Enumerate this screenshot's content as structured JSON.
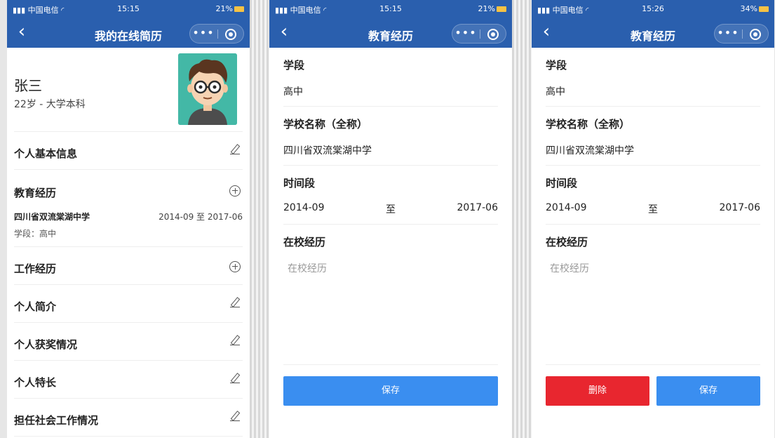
{
  "status": {
    "carrier": "中国电信",
    "panel1_time": "15:15",
    "panel2_time": "15:15",
    "panel3_time": "15:26",
    "panel1_battery": "21%",
    "panel2_battery": "21%",
    "panel3_battery": "34%"
  },
  "resume": {
    "nav_title": "我的在线简历",
    "name": "张三",
    "meta": "22岁 - 大学本科",
    "sections": {
      "basic": "个人基本信息",
      "education": "教育经历",
      "work": "工作经历",
      "intro": "个人简介",
      "awards": "个人获奖情况",
      "skills": "个人特长",
      "social": "担任社会工作情况"
    },
    "education_entry": {
      "school": "四川省双流棠湖中学",
      "dates": "2014-09 至 2017-06",
      "stage": "学段：高中"
    }
  },
  "edu_form": {
    "nav_title": "教育经历",
    "stage_label": "学段",
    "stage_value": "高中",
    "school_label": "学校名称（全称）",
    "school_value": "四川省双流棠湖中学",
    "period_label": "时间段",
    "period_from": "2014-09",
    "period_to_word": "至",
    "period_to": "2017-06",
    "experience_label": "在校经历",
    "experience_placeholder": "在校经历",
    "save_label": "保存",
    "delete_label": "删除"
  },
  "colors": {
    "nav_bg": "#2a5fae",
    "save_button": "#3a8ef0",
    "delete_button": "#e8262f",
    "avatar_bg": "#43b8a6"
  },
  "icons": {
    "back": "chevron-left-icon",
    "more": "more-dots-icon",
    "close_target": "target-icon",
    "edit": "pencil-icon",
    "add": "plus-circle-icon"
  }
}
